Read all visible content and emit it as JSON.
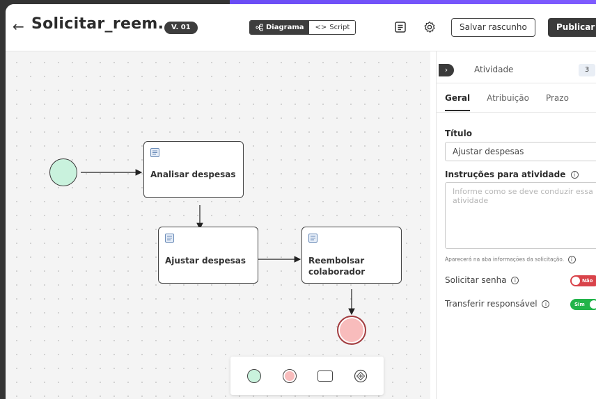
{
  "header": {
    "title": "Solicitar_reem...",
    "version": "V. 01",
    "view_toggle": {
      "diagram_label": "Diagrama",
      "script_label": "Script",
      "active": "Diagrama"
    },
    "save_draft_label": "Salvar rascunho",
    "publish_label": "Publicar"
  },
  "canvas": {
    "nodes": [
      {
        "id": "analisar",
        "label": "Analisar despesas"
      },
      {
        "id": "ajustar",
        "label": "Ajustar despesas"
      },
      {
        "id": "reembolsar",
        "label": "Reembolsar\ncolaborador"
      }
    ],
    "start_event_color": "#c9f2dd",
    "end_event_color": "#f8bcbc"
  },
  "palette": {
    "tools": [
      "start-event-tool",
      "end-event-tool",
      "task-tool",
      "gateway-tool"
    ]
  },
  "panel": {
    "title": "Atividade",
    "count": "3",
    "tabs": [
      "Geral",
      "Atribuição",
      "Prazo"
    ],
    "active_tab": "Geral",
    "title_label": "Título",
    "title_value": "Ajustar despesas",
    "instructions_label": "Instruções para atividade",
    "instructions_placeholder": "Informe como se deve conduzir essa atividade",
    "helper_text": "Aparecerá na aba informações da solicitação.",
    "password_label": "Solicitar senha",
    "password_toggle": "Não",
    "transfer_label": "Transferir responsável",
    "transfer_toggle": "Sim"
  },
  "colors": {
    "accent": "#6a4cf5",
    "toggle_off": "#d9434a",
    "toggle_on": "#22b44a"
  }
}
